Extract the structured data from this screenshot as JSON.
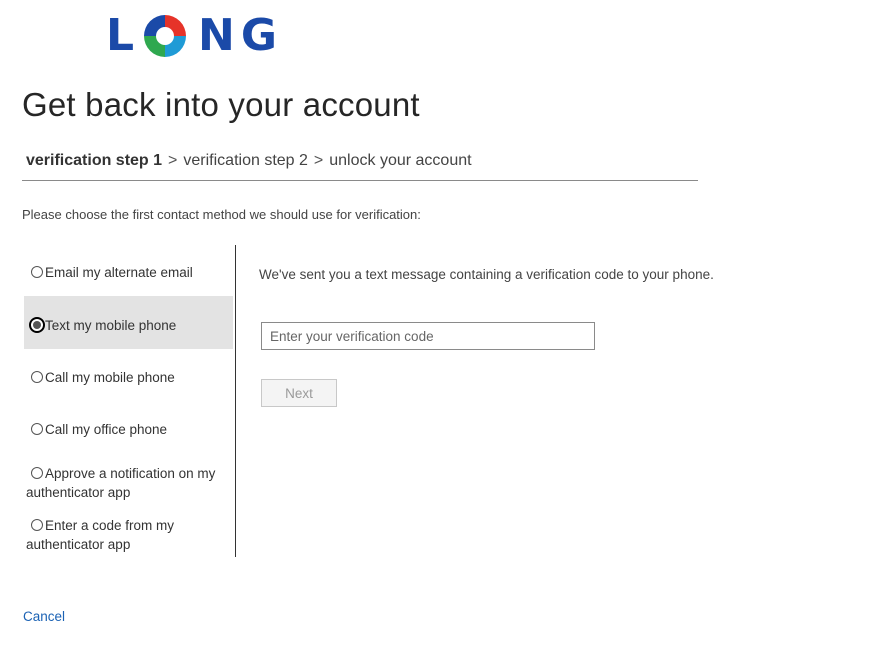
{
  "logo": {
    "letters": [
      "L",
      "N",
      "G"
    ],
    "colors": {
      "blue": "#1b4aa8",
      "red": "#e63329",
      "green": "#2fa84f",
      "lightblue": "#1f9bd6"
    }
  },
  "title": "Get back into your account",
  "breadcrumb": {
    "step1": "verification step 1",
    "separator": ">",
    "step2": "verification step 2",
    "step3": "unlock your account"
  },
  "instruction": "Please choose the first contact method we should use for verification:",
  "options": [
    {
      "label_line1": "Email my alternate email",
      "label_line2": "",
      "selected": false
    },
    {
      "label_line1": "Text my mobile phone",
      "label_line2": "",
      "selected": true
    },
    {
      "label_line1": "Call my mobile phone",
      "label_line2": "",
      "selected": false
    },
    {
      "label_line1": "Call my office phone",
      "label_line2": "",
      "selected": false
    },
    {
      "label_line1": "Approve a notification on my",
      "label_line2": "authenticator app",
      "selected": false
    },
    {
      "label_line1": "Enter a code from my",
      "label_line2": "authenticator app",
      "selected": false
    }
  ],
  "panel": {
    "message": "We've sent you a text message containing a verification code to your phone.",
    "code_placeholder": "Enter your verification code",
    "code_value": "",
    "next_label": "Next"
  },
  "cancel_label": "Cancel"
}
